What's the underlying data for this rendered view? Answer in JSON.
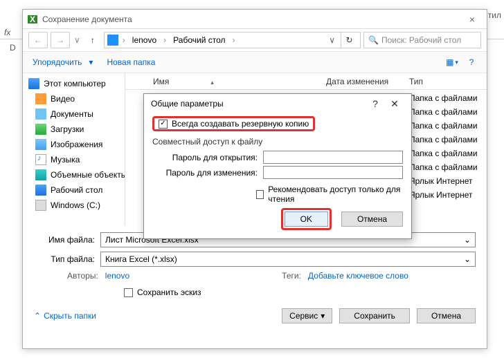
{
  "bg": {
    "fx": "fx",
    "col": "D",
    "stil": "Стил"
  },
  "window": {
    "title": "Сохранение документа",
    "close": "×"
  },
  "nav": {
    "back": "←",
    "fwd": "→",
    "up": "↑",
    "crumb_root": "lenovo",
    "crumb_sep": "›",
    "crumb_leaf": "Рабочий стол",
    "dd": "∨",
    "refresh": "↻",
    "search_placeholder": "Поиск: Рабочий стол",
    "search_icon": "🔍"
  },
  "toolbar": {
    "organize": "Упорядочить",
    "dd": "▾",
    "new_folder": "Новая папка",
    "view_icon": "▦",
    "help_icon": "?"
  },
  "sidebar": {
    "items": [
      "Этот компьютер",
      "Видео",
      "Документы",
      "Загрузки",
      "Изображения",
      "Музыка",
      "Объемные объекты",
      "Рабочий стол",
      "Windows (C:)"
    ]
  },
  "columns": {
    "name": "Имя",
    "date": "Дата изменения",
    "type": "Тип",
    "caret": "▴"
  },
  "rows": [
    {
      "type": "Папка с файлами"
    },
    {
      "type": "Папка с файлами"
    },
    {
      "type": "Папка с файлами"
    },
    {
      "type": "Папка с файлами"
    },
    {
      "type": "Папка с файлами"
    },
    {
      "type": "Папка с файлами"
    },
    {
      "type": "Ярлык Интернет"
    },
    {
      "type": "Ярлык Интернет"
    }
  ],
  "form": {
    "filename_label": "Имя файла:",
    "filename_value": "Лист Microsoft Excel.xlsx",
    "filetype_label": "Тип файла:",
    "filetype_value": "Книга Excel (*.xlsx)",
    "authors_label": "Авторы:",
    "authors_value": "lenovo",
    "tags_label": "Теги:",
    "tags_value": "Добавьте ключевое слово",
    "thumb_label": "Сохранить эскиз"
  },
  "footer": {
    "hide": "Скрыть папки",
    "hide_caret": "⌃",
    "service": "Сервис",
    "service_dd": "▾",
    "save": "Сохранить",
    "cancel": "Отмена"
  },
  "modal": {
    "title": "Общие параметры",
    "q": "?",
    "x": "✕",
    "backup_label": "Всегда создавать резервную копию",
    "section": "Совместный доступ к файлу",
    "pw_open": "Пароль для открытия:",
    "pw_edit": "Пароль для изменения:",
    "recommend": "Рекомендовать доступ только для чтения",
    "ok": "OK",
    "cancel": "Отмена"
  }
}
